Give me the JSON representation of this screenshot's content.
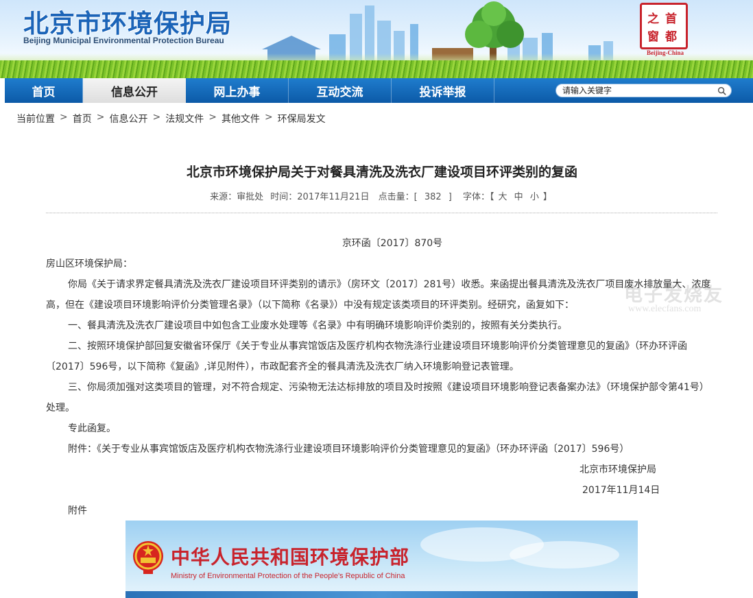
{
  "header": {
    "title": "北京市环境保护局",
    "subtitle_en": "Beijing Municipal Environmental Protection Bureau",
    "seal": {
      "chars": [
        "首",
        "都",
        "之",
        "窗"
      ],
      "caption": "Beijing-China"
    },
    "colors": {
      "brand_blue": "#1b64b8",
      "seal_red": "#c8232c"
    }
  },
  "nav": {
    "items": [
      {
        "label": "首页"
      },
      {
        "label": "信息公开",
        "active": true
      },
      {
        "label": "网上办事"
      },
      {
        "label": "互动交流"
      },
      {
        "label": "投诉举报"
      }
    ],
    "search": {
      "placeholder": "请输入关键字",
      "icon": "search-icon"
    }
  },
  "breadcrumb": {
    "prefix": "当前位置",
    "items": [
      "首页",
      "信息公开",
      "法规文件",
      "其他文件",
      "环保局发文"
    ]
  },
  "article": {
    "title": "北京市环境保护局关于对餐具清洗及洗衣厂建设项目环评类别的复函",
    "meta": {
      "source": "来源：审批处",
      "time": "时间：2017年11月21日",
      "hits_label": "点击量：[",
      "hits": "382",
      "hits_close": "]",
      "font_label": "字体：【",
      "font_large": "大",
      "font_medium": "中",
      "font_small": "小",
      "font_close": "】"
    },
    "doc_number": "京环函〔2017〕870号",
    "addressee": "房山区环境保护局：",
    "paragraphs": [
      "你局《关于请求界定餐具清洗及洗衣厂建设项目环评类别的请示》（房环文〔2017〕281号）收悉。来函提出餐具清洗及洗衣厂项目废水排放量大、浓度高，但在《建设项目环境影响评价分类管理名录》（以下简称《名录》）中没有规定该类项目的环评类别。经研究，函复如下：",
      "一、餐具清洗及洗衣厂建设项目中如包含工业废水处理等《名录》中有明确环境影响评价类别的，按照有关分类执行。",
      "二、按照环境保护部回复安徽省环保厅《关于专业从事宾馆饭店及医疗机构衣物洗涤行业建设项目环境影响评价分类管理意见的复函》（环办环评函〔2017〕596号，以下简称《复函》,详见附件），市政配套齐全的餐具清洗及洗衣厂纳入环境影响登记表管理。",
      "三、你局须加强对这类项目的管理，对不符合规定、污染物无法达标排放的项目及时按照《建设项目环境影响登记表备案办法》（环境保护部令第41号）处理。",
      "专此函复。",
      "附件：《关于专业从事宾馆饭店及医疗机构衣物洗涤行业建设项目环境影响评价分类管理意见的复函》（环办环评函〔2017〕596号）"
    ],
    "signature": "北京市环境保护局",
    "date": "2017年11月14日",
    "attachment_label": "附件"
  },
  "watermark": {
    "text": "电子发烧友",
    "url": "www.elecfans.com"
  },
  "attachment_image": {
    "title_ch": "中华人民共和国环境保护部",
    "title_en": "Ministry of Environmental Protection of the People's Republic of China",
    "icon": "national-emblem-icon"
  }
}
